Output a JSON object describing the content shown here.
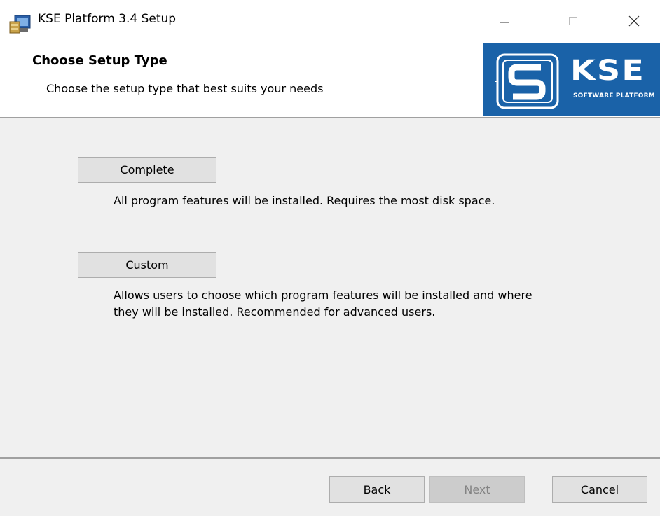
{
  "window": {
    "title": "KSE Platform 3.4 Setup",
    "icons": [
      "setup-app-icon",
      "minimize-icon",
      "maximize-icon",
      "close-icon"
    ]
  },
  "header": {
    "title": "Choose Setup Type",
    "subtitle": "Choose the setup type that best suits your needs",
    "logo": {
      "word": "KSE",
      "tagline": "SOFTWARE PLATFORM",
      "background": "#1a62a8"
    }
  },
  "options": [
    {
      "label": "Complete",
      "description": "All program features will be installed. Requires the most disk space."
    },
    {
      "label": "Custom",
      "description_lines": [
        "Allows users to choose which program features will be installed and where",
        "they will be installed. Recommended for advanced users."
      ]
    }
  ],
  "footer": {
    "back_label": "Back",
    "next_label": "Next",
    "cancel_label": "Cancel",
    "next_disabled": true
  },
  "colors": {
    "panel_bg": "#f0f0f0",
    "button_bg": "#e1e1e1",
    "logo_blue": "#1a62a8"
  }
}
